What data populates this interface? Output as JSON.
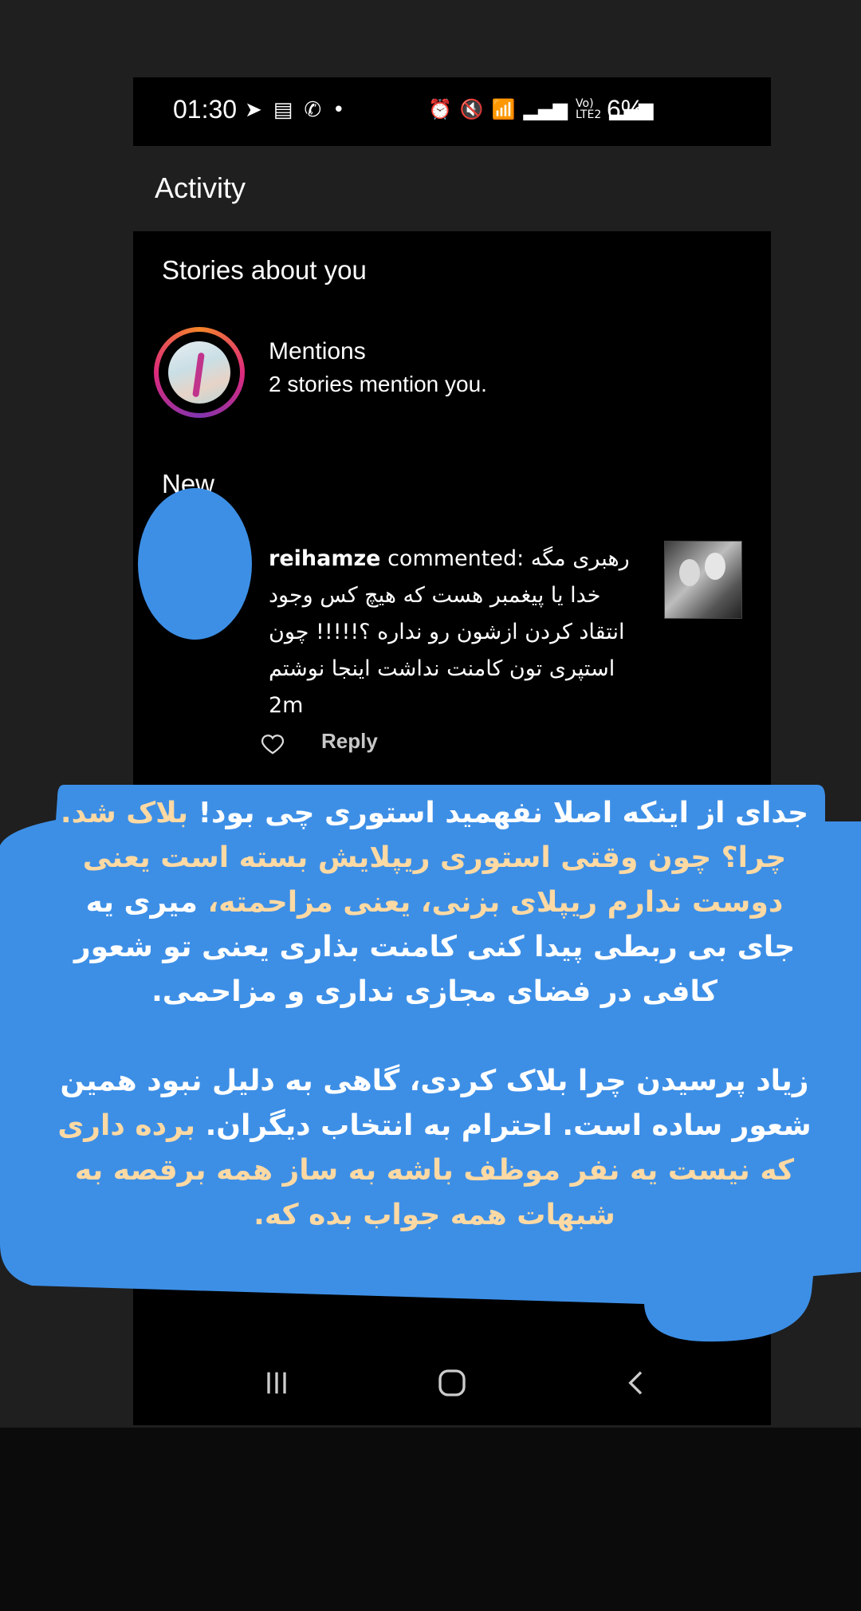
{
  "status_bar": {
    "time": "01:30",
    "battery": "6%",
    "left_icons": [
      "telegram-icon",
      "calendar-icon",
      "missed-call-icon",
      "dot-icon"
    ],
    "right_icons": [
      "alarm-icon",
      "mute-icon",
      "wifi-icon",
      "signal-icon",
      "volte-icon",
      "signal-icon",
      "battery-icon"
    ]
  },
  "header": {
    "title": "Activity"
  },
  "sections": {
    "stories_title": "Stories about you",
    "new_title": "New"
  },
  "mentions": {
    "title": "Mentions",
    "subtitle": "2 stories mention you."
  },
  "comment": {
    "username": "reihamze",
    "action": "commented:",
    "lines": [
      "رهبری مگه",
      "خدا یا پیغمبر هست که هیچ کس وجود",
      "انتقاد کردن ازشون رو نداره ؟!!!!! چون",
      "استپری تون کامنت نداشت اینجا نوشتم",
      "2m"
    ],
    "reply_label": "Reply"
  },
  "overlay": {
    "p1_a": "جدای از اینکه اصلا نفهمید استوری چی بود!",
    "p1_b": "بلاک شد.",
    "p1_c": "چرا؟ چون وقتی استوری ریپلایش بسته است یعنی دوست ندارم ریپلای بزنی، یعنی مزاحمته،",
    "p1_d": "میری یه جای بی ربطی پیدا کنی کامنت بذاری یعنی تو شعور کافی در فضای مجازی نداری و مزاحمی.",
    "p2_a": "زیاد پرسیدن چرا بلاک کردی، گاهی به دلیل نبود همین شعور ساده است. احترام به انتخاب دیگران.",
    "p2_b": "برده داری که نیست یه نفر موظف باشه به ساز همه برقصه به شبهات همه جواب بده که."
  },
  "colors": {
    "overlay_blue": "#3d8fe6",
    "highlight_peach": "#fdd9a3",
    "background": "#1f1f1f"
  }
}
